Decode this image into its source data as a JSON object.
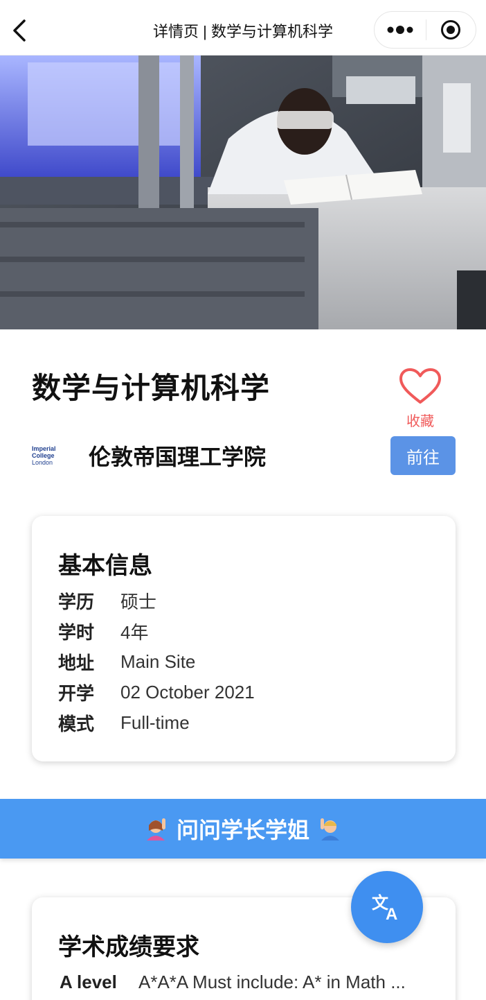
{
  "navbar": {
    "title": "详情页 | 数学与计算机科学",
    "back_icon": "chevron-left-icon",
    "more_icon": "more-dots-icon",
    "target_icon": "record-target-icon"
  },
  "hero": {
    "image": "laboratory-researcher-photo"
  },
  "program": {
    "title": "数学与计算机科学",
    "favorite_label": "收藏",
    "favorite_icon": "heart-outline-icon",
    "favorite_color": "#f05a5a"
  },
  "school": {
    "logo_line1": "Imperial College",
    "logo_line2": "London",
    "name": "伦敦帝国理工学院",
    "goto_label": "前往",
    "goto_color": "#5b93e6"
  },
  "basic_info": {
    "title": "基本信息",
    "rows": [
      {
        "key": "学历",
        "value": "硕士"
      },
      {
        "key": "学时",
        "value": "4年"
      },
      {
        "key": "地址",
        "value": "Main Site"
      },
      {
        "key": "开学",
        "value": "02 October 2021"
      },
      {
        "key": "模式",
        "value": "Full-time"
      }
    ]
  },
  "ask_banner": {
    "label": "问问学长学姐",
    "left_icon": "raising-hand-woman-icon",
    "right_icon": "raising-hand-man-icon",
    "color": "#4a99f2"
  },
  "academic": {
    "title": "学术成绩要求",
    "rows": [
      {
        "key": "A level",
        "value": "A*A*A Must include: A* in Math ... tics, A* in Further Ma"
      }
    ]
  },
  "fab": {
    "icon": "translate-icon",
    "color": "#3f8ff0"
  }
}
